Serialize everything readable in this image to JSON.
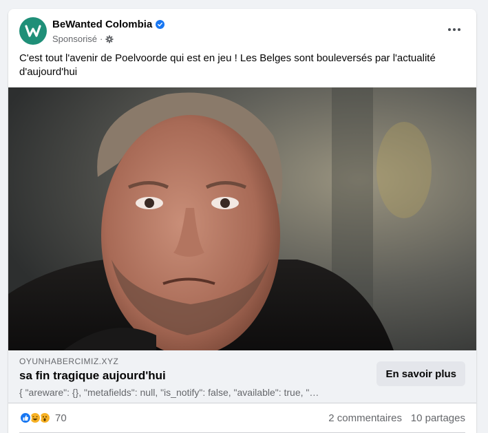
{
  "post": {
    "page_name": "BeWanted Colombia",
    "sponsored_label": "Sponsorisé",
    "separator": "·",
    "text": "C'est tout l'avenir de Poelvoorde qui est en jeu ! Les Belges sont bouleversés par l'actualité d'aujourd'hui"
  },
  "link_preview": {
    "domain": "OYUNHABERCIMIZ.XYZ",
    "title": "sa fin tragique aujourd'hui",
    "description": "{ \"areware\": {}, \"metafields\": null, \"is_notify\": false, \"available\": true, \"…",
    "cta_label": "En savoir plus"
  },
  "stats": {
    "reaction_count": "70",
    "comments": "2 commentaires",
    "shares": "10 partages"
  },
  "icons": {
    "avatar": "bewanted-logo-icon",
    "verified": "verified-badge-icon",
    "audience": "gear-icon",
    "more": "more-options-icon",
    "reactions": [
      "like-icon",
      "haha-icon",
      "wow-icon"
    ]
  },
  "colors": {
    "brand_green": "#1f8f78",
    "verified_blue": "#1877f2",
    "secondary_text": "#65676b",
    "link_box_bg": "#f0f2f5",
    "cta_bg": "#e4e6eb"
  }
}
